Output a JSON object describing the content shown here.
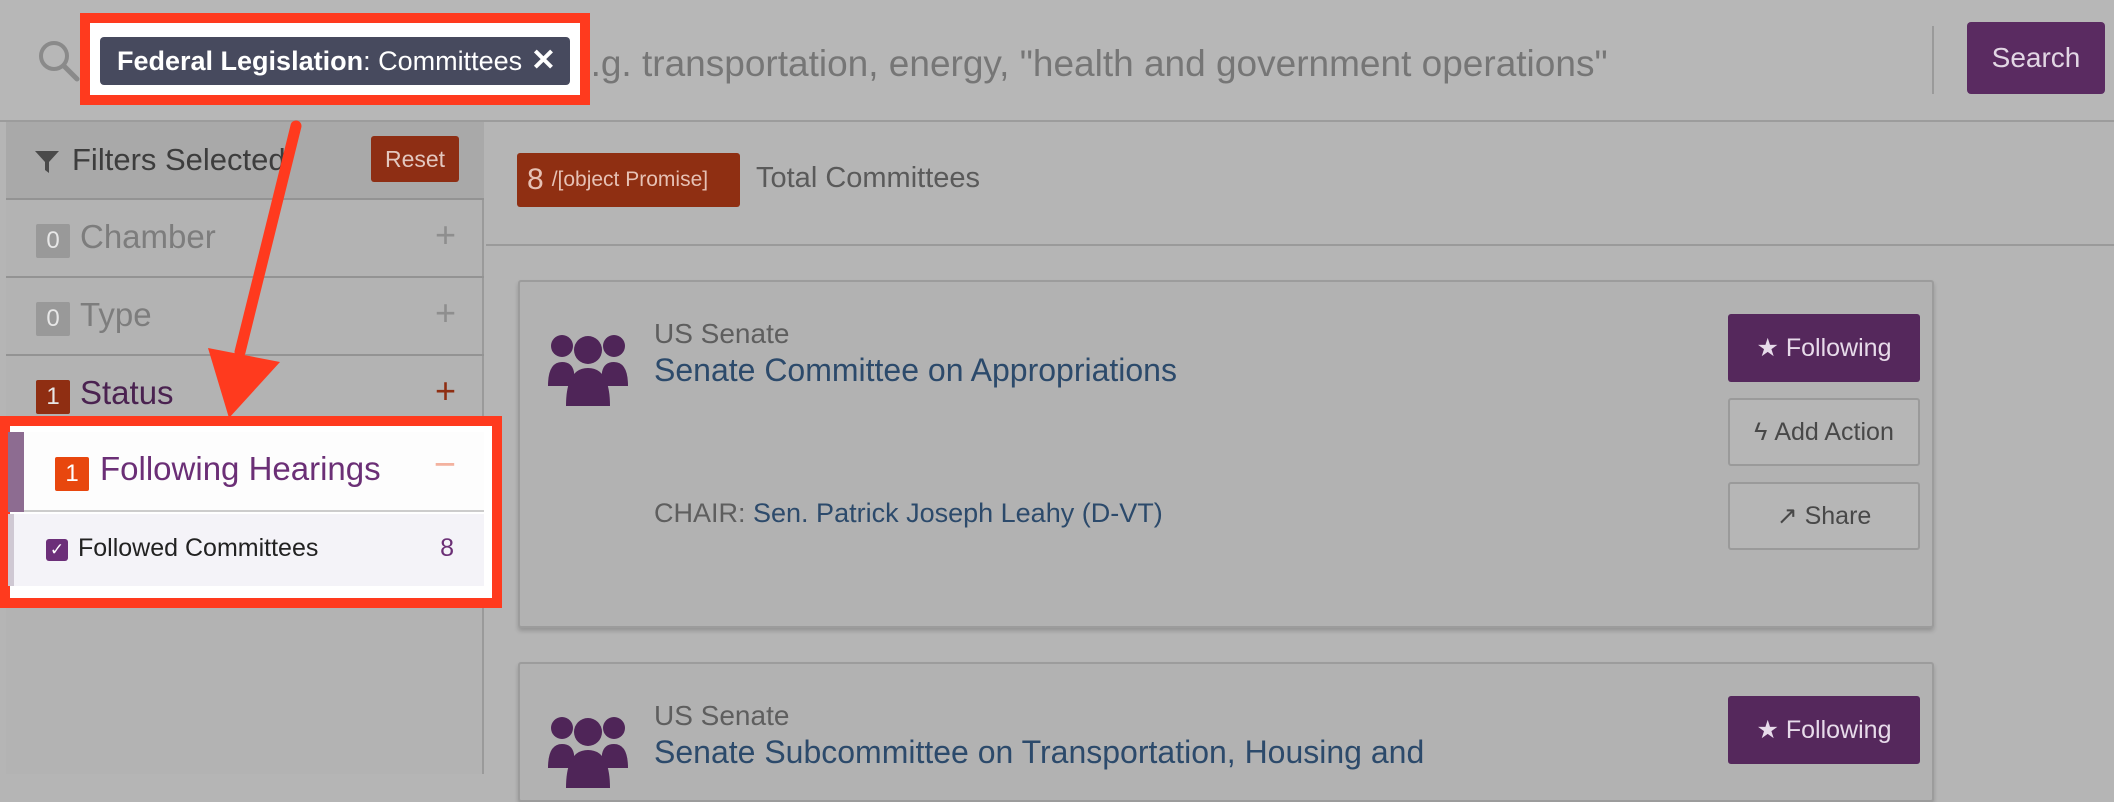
{
  "search": {
    "placeholder": "e.g. transportation, energy, \"health and government operations\"",
    "button_label": "Search"
  },
  "chip": {
    "bold": "Federal Legislation",
    "rest": ": Committees",
    "close": "✕"
  },
  "sidebar": {
    "header": "Filters Selected",
    "reset": "Reset",
    "facets": [
      {
        "count": "0",
        "label": "Chamber",
        "toggle": "+"
      },
      {
        "count": "0",
        "label": "Type",
        "toggle": "+"
      },
      {
        "count": "1",
        "label": "Status",
        "toggle": "+"
      }
    ],
    "following": {
      "count": "1",
      "label": "Following Hearings",
      "toggle": "−",
      "item_label": "Followed Committees",
      "item_count": "8"
    }
  },
  "results": {
    "count": "8",
    "promise": "/[object Promise]",
    "total_label": "Total Committees"
  },
  "cards": [
    {
      "chamber": "US Senate",
      "name": "Senate Committee on Appropriations",
      "chair_label": "CHAIR: ",
      "chair_name": "Sen. Patrick Joseph Leahy (D-VT)",
      "following": "Following",
      "add_action": "Add Action",
      "share": "Share"
    },
    {
      "chamber": "US Senate",
      "name": "Senate Subcommittee on Transportation, Housing and",
      "following": "Following"
    }
  ],
  "colors": {
    "highlight": "#ff3a1e",
    "brand_purple": "#5a2b61",
    "badge_orange": "#e8470e"
  }
}
